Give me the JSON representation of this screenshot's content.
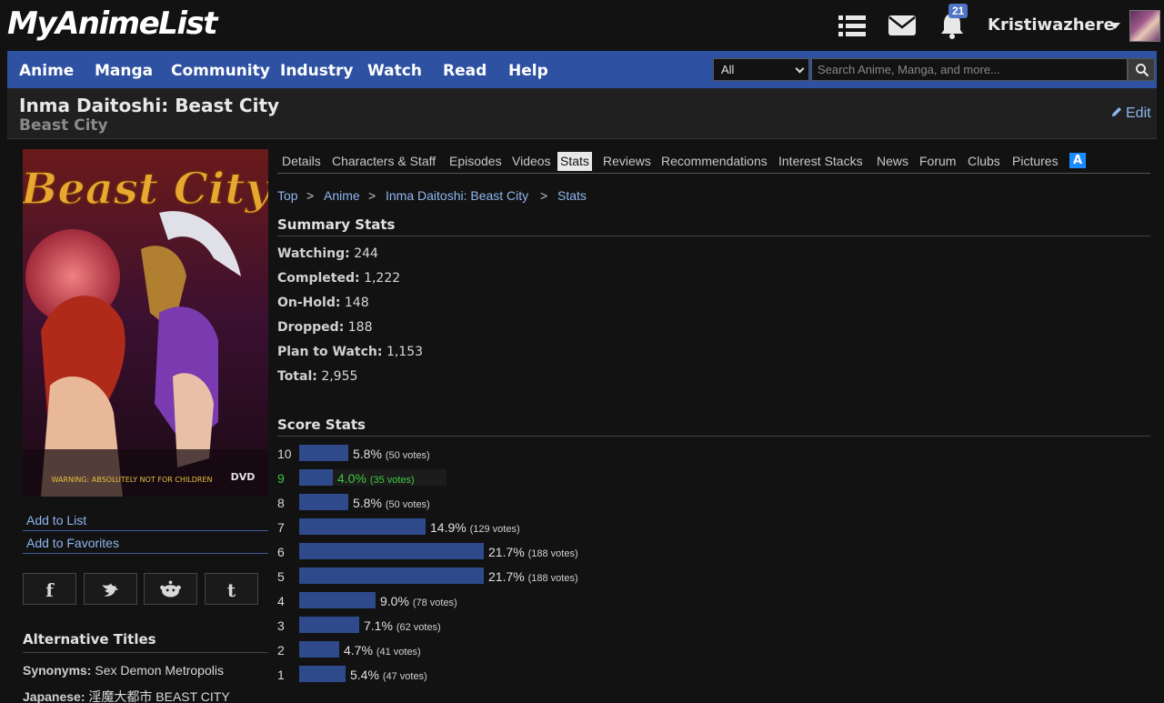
{
  "header": {
    "logo": "MyAnimeList",
    "notification_count": "21",
    "username": "Kristiwazhere"
  },
  "nav": {
    "items": [
      "Anime",
      "Manga",
      "Community",
      "Industry",
      "Watch",
      "Read",
      "Help"
    ],
    "search_select": "All",
    "search_placeholder": "Search Anime, Manga, and more..."
  },
  "title": {
    "main": "Inma Daitoshi: Beast City",
    "english": "Beast City",
    "edit": "Edit"
  },
  "cover": {
    "title_text": "Beast City",
    "warning": "WARNING: ABSOLUTELY NOT FOR CHILDREN",
    "badge": "DVD"
  },
  "sidebar": {
    "add_to_list": "Add to List",
    "add_to_favorites": "Add to Favorites",
    "share": [
      "f",
      "t",
      "r",
      "t"
    ],
    "alt_titles_head": "Alternative Titles",
    "synonyms_label": "Synonyms:",
    "synonyms_value": "Sex Demon Metropolis",
    "japanese_label": "Japanese:",
    "japanese_value": "淫魔大都市 BEAST CITY"
  },
  "tabs": [
    "Details",
    "Characters & Staff",
    "Episodes",
    "Videos",
    "Stats",
    "Reviews",
    "Recommendations",
    "Interest Stacks",
    "News",
    "Forum",
    "Clubs",
    "Pictures"
  ],
  "tab_logo": "A",
  "breadcrumb": {
    "items": [
      "Top",
      "Anime",
      "Inma Daitoshi: Beast City",
      "Stats"
    ],
    "separator": ">"
  },
  "summary": {
    "head": "Summary Stats",
    "rows": [
      {
        "label": "Watching:",
        "value": "244"
      },
      {
        "label": "Completed:",
        "value": "1,222"
      },
      {
        "label": "On-Hold:",
        "value": "148"
      },
      {
        "label": "Dropped:",
        "value": "188"
      },
      {
        "label": "Plan to Watch:",
        "value": "1,153"
      },
      {
        "label": "Total:",
        "value": "2,955"
      }
    ]
  },
  "score_stats": {
    "head": "Score Stats",
    "rows": [
      {
        "score": "10",
        "pct": 5.8,
        "pct_label": "5.8%",
        "votes": "(50 votes)"
      },
      {
        "score": "9",
        "pct": 4.0,
        "pct_label": "4.0%",
        "votes": "(35 votes)",
        "highlight": true
      },
      {
        "score": "8",
        "pct": 5.8,
        "pct_label": "5.8%",
        "votes": "(50 votes)"
      },
      {
        "score": "7",
        "pct": 14.9,
        "pct_label": "14.9%",
        "votes": "(129 votes)"
      },
      {
        "score": "6",
        "pct": 21.7,
        "pct_label": "21.7%",
        "votes": "(188 votes)"
      },
      {
        "score": "5",
        "pct": 21.7,
        "pct_label": "21.7%",
        "votes": "(188 votes)"
      },
      {
        "score": "4",
        "pct": 9.0,
        "pct_label": "9.0%",
        "votes": "(78 votes)"
      },
      {
        "score": "3",
        "pct": 7.1,
        "pct_label": "7.1%",
        "votes": "(62 votes)"
      },
      {
        "score": "2",
        "pct": 4.7,
        "pct_label": "4.7%",
        "votes": "(41 votes)"
      },
      {
        "score": "1",
        "pct": 5.4,
        "pct_label": "5.4%",
        "votes": "(47 votes)"
      }
    ]
  },
  "colors": {
    "nav_blue": "#2e51a2",
    "link_blue": "#8fb6f0",
    "bar_blue": "#2e4a8a",
    "highlight_green": "#3ec63e"
  }
}
